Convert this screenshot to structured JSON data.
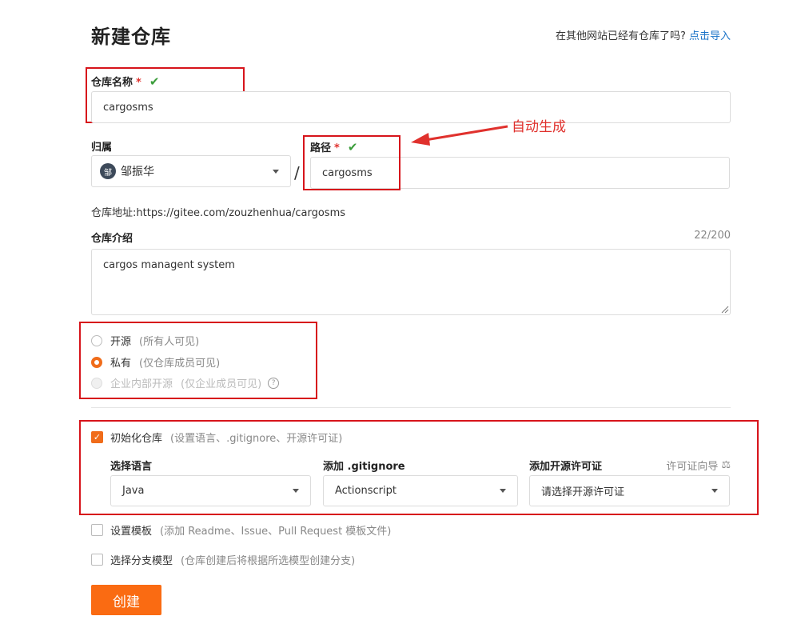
{
  "page_title": "新建仓库",
  "import_prompt": "在其他网站已经有仓库了吗?",
  "import_link": "点击导入",
  "repo_name": {
    "label": "仓库名称",
    "required": "*",
    "value": "cargosms"
  },
  "owner": {
    "label": "归属",
    "avatar_text": "邹",
    "value": "邹振华"
  },
  "path_separator": "/",
  "path": {
    "label": "路径",
    "required": "*",
    "value": "cargosms"
  },
  "annotation": "自动生成",
  "repo_address": {
    "label": "仓库地址:",
    "value": "https://gitee.com/zouzhenhua/cargosms"
  },
  "description": {
    "label": "仓库介绍",
    "counter": "22/200",
    "value": "cargos managent system"
  },
  "visibility": [
    {
      "label": "开源",
      "hint": "(所有人可见)",
      "state": "unchecked"
    },
    {
      "label": "私有",
      "hint": "(仅仓库成员可见)",
      "state": "checked"
    },
    {
      "label": "企业内部开源",
      "hint": "(仅企业成员可见)",
      "state": "disabled"
    }
  ],
  "init_repo": {
    "label": "初始化仓库",
    "hint": "(设置语言、.gitignore、开源许可证)",
    "checked": true
  },
  "language": {
    "label": "选择语言",
    "value": "Java"
  },
  "gitignore": {
    "label": "添加 .gitignore",
    "value": "Actionscript"
  },
  "license": {
    "label": "添加开源许可证",
    "guide": "许可证向导",
    "value": "请选择开源许可证"
  },
  "template": {
    "label": "设置模板",
    "hint": "(添加 Readme、Issue、Pull Request 模板文件)",
    "checked": false
  },
  "branch": {
    "label": "选择分支模型",
    "hint": "(仓库创建后将根据所选模型创建分支)",
    "checked": false
  },
  "create_button": "创建",
  "colors": {
    "accent": "#fa6b12",
    "annotation": "#e0312d",
    "link": "#1a73c8",
    "ok": "#3a9d3a"
  }
}
